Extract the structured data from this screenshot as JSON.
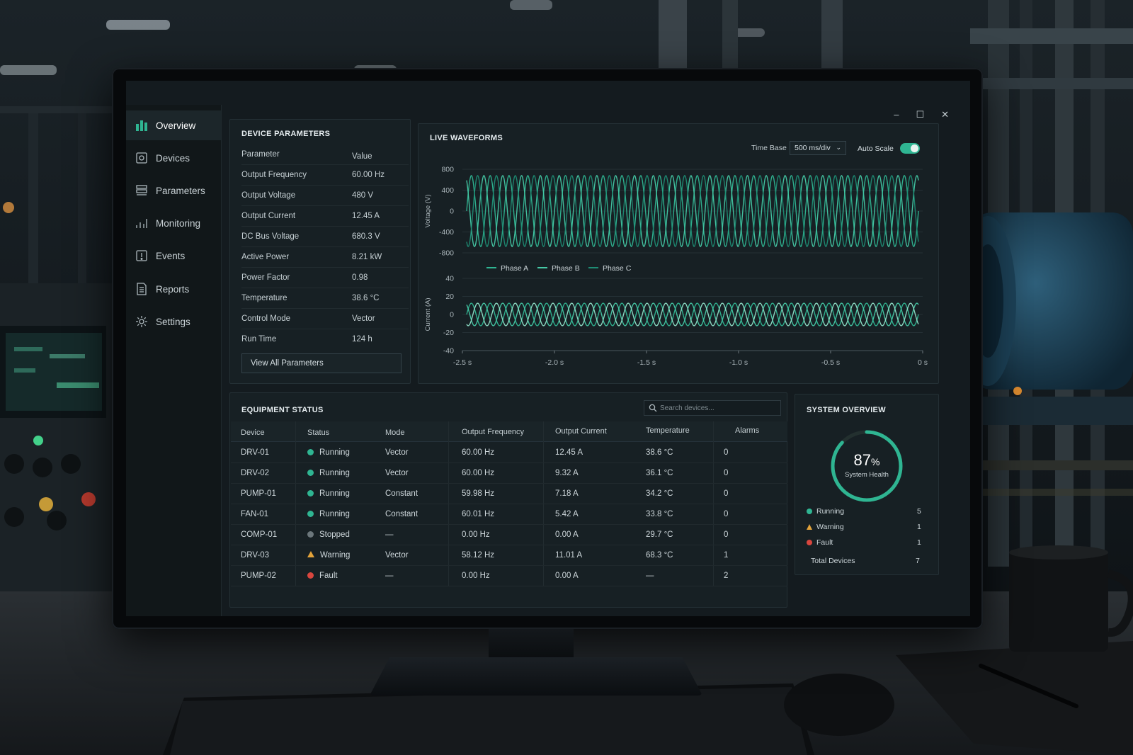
{
  "sidebar": {
    "items": [
      {
        "label": "Overview",
        "icon": "bar-chart-icon",
        "active": true
      },
      {
        "label": "Devices",
        "icon": "device-icon"
      },
      {
        "label": "Parameters",
        "icon": "list-icon"
      },
      {
        "label": "Monitoring",
        "icon": "monitoring-icon"
      },
      {
        "label": "Events",
        "icon": "events-icon"
      },
      {
        "label": "Reports",
        "icon": "report-icon"
      },
      {
        "label": "Settings",
        "icon": "gear-icon"
      }
    ]
  },
  "window_controls": {
    "minimize": "–",
    "maximize": "☐",
    "close": "✕"
  },
  "device_parameters": {
    "title": "DEVICE PARAMETERS",
    "header": {
      "param": "Parameter",
      "value": "Value"
    },
    "rows": [
      {
        "param": "Output Frequency",
        "value": "60.00 Hz"
      },
      {
        "param": "Output Voltage",
        "value": "480 V"
      },
      {
        "param": "Output Current",
        "value": "12.45 A"
      },
      {
        "param": "DC Bus Voltage",
        "value": "680.3 V"
      },
      {
        "param": "Active Power",
        "value": "8.21 kW"
      },
      {
        "param": "Power Factor",
        "value": "0.98"
      },
      {
        "param": "Temperature",
        "value": "38.6 °C"
      },
      {
        "param": "Control Mode",
        "value": "Vector"
      },
      {
        "param": "Run Time",
        "value": "124 h"
      }
    ],
    "button": "View All Parameters"
  },
  "waveforms": {
    "title": "LIVE WAVEFORMS",
    "time_base_label": "Time Base",
    "time_base_value": "500 ms/div",
    "auto_scale_label": "Auto Scale",
    "auto_scale_on": true
  },
  "chart_data": [
    {
      "type": "line",
      "ylabel": "Voltage (V)",
      "ylim": [
        -800,
        800
      ],
      "yticks": [
        "800",
        "400",
        "0",
        "-400",
        "-800"
      ],
      "x_range": [
        -2.5,
        0
      ],
      "amplitude": 680,
      "cycles": 24,
      "series": [
        {
          "name": "Phase A",
          "phase_deg": 0,
          "color": "#2fb592"
        },
        {
          "name": "Phase B",
          "phase_deg": 120,
          "color": "#46c9a6"
        },
        {
          "name": "Phase C",
          "phase_deg": 240,
          "color": "#1e8c74"
        }
      ],
      "legend": "bottom-left"
    },
    {
      "type": "line",
      "ylabel": "Current (A)",
      "ylim": [
        -40,
        40
      ],
      "yticks": [
        "40",
        "20",
        "0",
        "-20",
        "-40"
      ],
      "x_range": [
        -2.5,
        0
      ],
      "xticks": [
        "-2.5 s",
        "-2.0 s",
        "-1.5 s",
        "-1.0 s",
        "-0.5 s",
        "0 s"
      ],
      "amplitude": 12.45,
      "cycles": 24,
      "series": [
        {
          "name": "Phase A",
          "phase_deg": 0,
          "color": "#2fb592"
        },
        {
          "name": "Phase B",
          "phase_deg": 120,
          "color": "#46c9a6"
        },
        {
          "name": "Phase C",
          "phase_deg": 240,
          "color": "#8fe0c8"
        }
      ]
    }
  ],
  "equipment": {
    "title": "EQUIPMENT STATUS",
    "search_placeholder": "Search devices...",
    "headers": [
      "Device",
      "Status",
      "Mode",
      "Output Frequency",
      "Output Current",
      "Temperature",
      "Alarms"
    ],
    "rows": [
      {
        "device": "DRV-01",
        "status": "Running",
        "status_kind": "running",
        "mode": "Vector",
        "freq": "60.00 Hz",
        "current": "12.45 A",
        "temp": "38.6 °C",
        "alarms": "0"
      },
      {
        "device": "DRV-02",
        "status": "Running",
        "status_kind": "running",
        "mode": "Vector",
        "freq": "60.00 Hz",
        "current": "9.32 A",
        "temp": "36.1 °C",
        "alarms": "0"
      },
      {
        "device": "PUMP-01",
        "status": "Running",
        "status_kind": "running",
        "mode": "Constant",
        "freq": "59.98 Hz",
        "current": "7.18 A",
        "temp": "34.2 °C",
        "alarms": "0"
      },
      {
        "device": "FAN-01",
        "status": "Running",
        "status_kind": "running",
        "mode": "Constant",
        "freq": "60.01 Hz",
        "current": "5.42 A",
        "temp": "33.8 °C",
        "alarms": "0"
      },
      {
        "device": "COMP-01",
        "status": "Stopped",
        "status_kind": "stopped",
        "mode": "—",
        "freq": "0.00 Hz",
        "current": "0.00 A",
        "temp": "29.7 °C",
        "alarms": "0"
      },
      {
        "device": "DRV-03",
        "status": "Warning",
        "status_kind": "warning",
        "mode": "Vector",
        "freq": "58.12 Hz",
        "current": "11.01 A",
        "temp": "68.3 °C",
        "alarms": "1"
      },
      {
        "device": "PUMP-02",
        "status": "Fault",
        "status_kind": "fault",
        "mode": "—",
        "freq": "0.00 Hz",
        "current": "0.00 A",
        "temp": "—",
        "alarms": "2"
      }
    ]
  },
  "overview": {
    "title": "SYSTEM OVERVIEW",
    "health_value": "87",
    "health_unit": "%",
    "health_fraction": 0.87,
    "health_label": "System Health",
    "rows": [
      {
        "label": "Running",
        "count": "5",
        "kind": "running"
      },
      {
        "label": "Warning",
        "count": "1",
        "kind": "warning"
      },
      {
        "label": "Fault",
        "count": "1",
        "kind": "fault"
      }
    ],
    "total_label": "Total Devices",
    "total_count": "7"
  },
  "colors": {
    "accent": "#2fb592",
    "running": "#2fb592",
    "stopped": "#6b767b",
    "warning": "#e3a33a",
    "fault": "#d9463e"
  }
}
